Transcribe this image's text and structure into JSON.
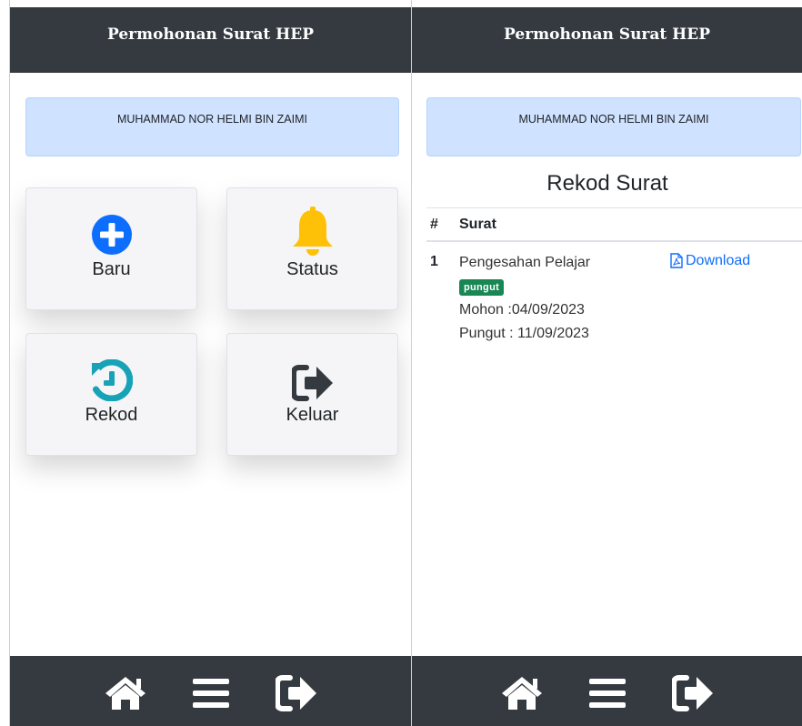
{
  "app": {
    "title": "Permohonan Surat HEP"
  },
  "user": {
    "name": "MUHAMMAD NOR HELMI BIN ZAIMI"
  },
  "menu": {
    "baru": "Baru",
    "status": "Status",
    "rekod": "Rekod",
    "keluar": "Keluar"
  },
  "icons": {
    "baru": "plus-circle-icon",
    "status": "bell-icon",
    "rekod": "history-icon",
    "keluar": "sign-out-icon",
    "home": "home-icon",
    "menu": "bars-icon",
    "logout": "sign-out-icon",
    "download": "file-pdf-icon"
  },
  "colors": {
    "header_bg": "#343a40",
    "name_bg": "#cfe2ff",
    "baru_icon": "#0d6efd",
    "status_icon": "#ffc107",
    "rekod_icon": "#17a2b8",
    "keluar_icon": "#343a40",
    "badge_bg": "#198754",
    "link": "#0d6efd"
  },
  "rekod": {
    "title": "Rekod Surat",
    "columns": [
      "#",
      "Surat"
    ],
    "rows": [
      {
        "no": "1",
        "surat": "Pengesahan Pelajar",
        "badge": "pungut",
        "mohon": "Mohon :04/09/2023",
        "pungut": "Pungut : 11/09/2023",
        "action": "Download"
      }
    ]
  }
}
